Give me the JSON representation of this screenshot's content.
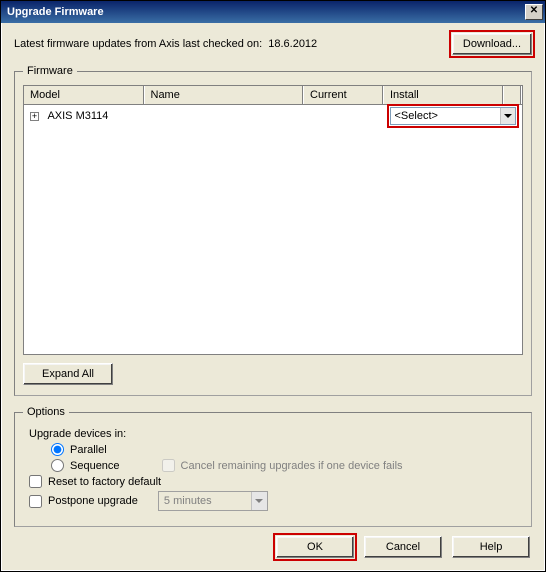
{
  "window": {
    "title": "Upgrade Firmware",
    "close_label": "✕"
  },
  "top": {
    "status_prefix": "Latest firmware updates from Axis last checked on:",
    "status_date": "18.6.2012",
    "download_label": "Download..."
  },
  "firmware": {
    "legend": "Firmware",
    "columns": {
      "model": "Model",
      "name": "Name",
      "current": "Current",
      "install": "Install"
    },
    "rows": [
      {
        "model": "AXIS M3114",
        "name": "",
        "current": "",
        "install": "<Select>"
      }
    ],
    "expand_all_label": "Expand All"
  },
  "options": {
    "legend": "Options",
    "upgrade_label": "Upgrade devices in:",
    "parallel_label": "Parallel",
    "sequence_label": "Sequence",
    "cancel_remaining_label": "Cancel remaining upgrades if one device fails",
    "reset_label": "Reset to factory default",
    "postpone_label": "Postpone upgrade",
    "postpone_value": "5 minutes"
  },
  "buttons": {
    "ok": "OK",
    "cancel": "Cancel",
    "help": "Help"
  }
}
